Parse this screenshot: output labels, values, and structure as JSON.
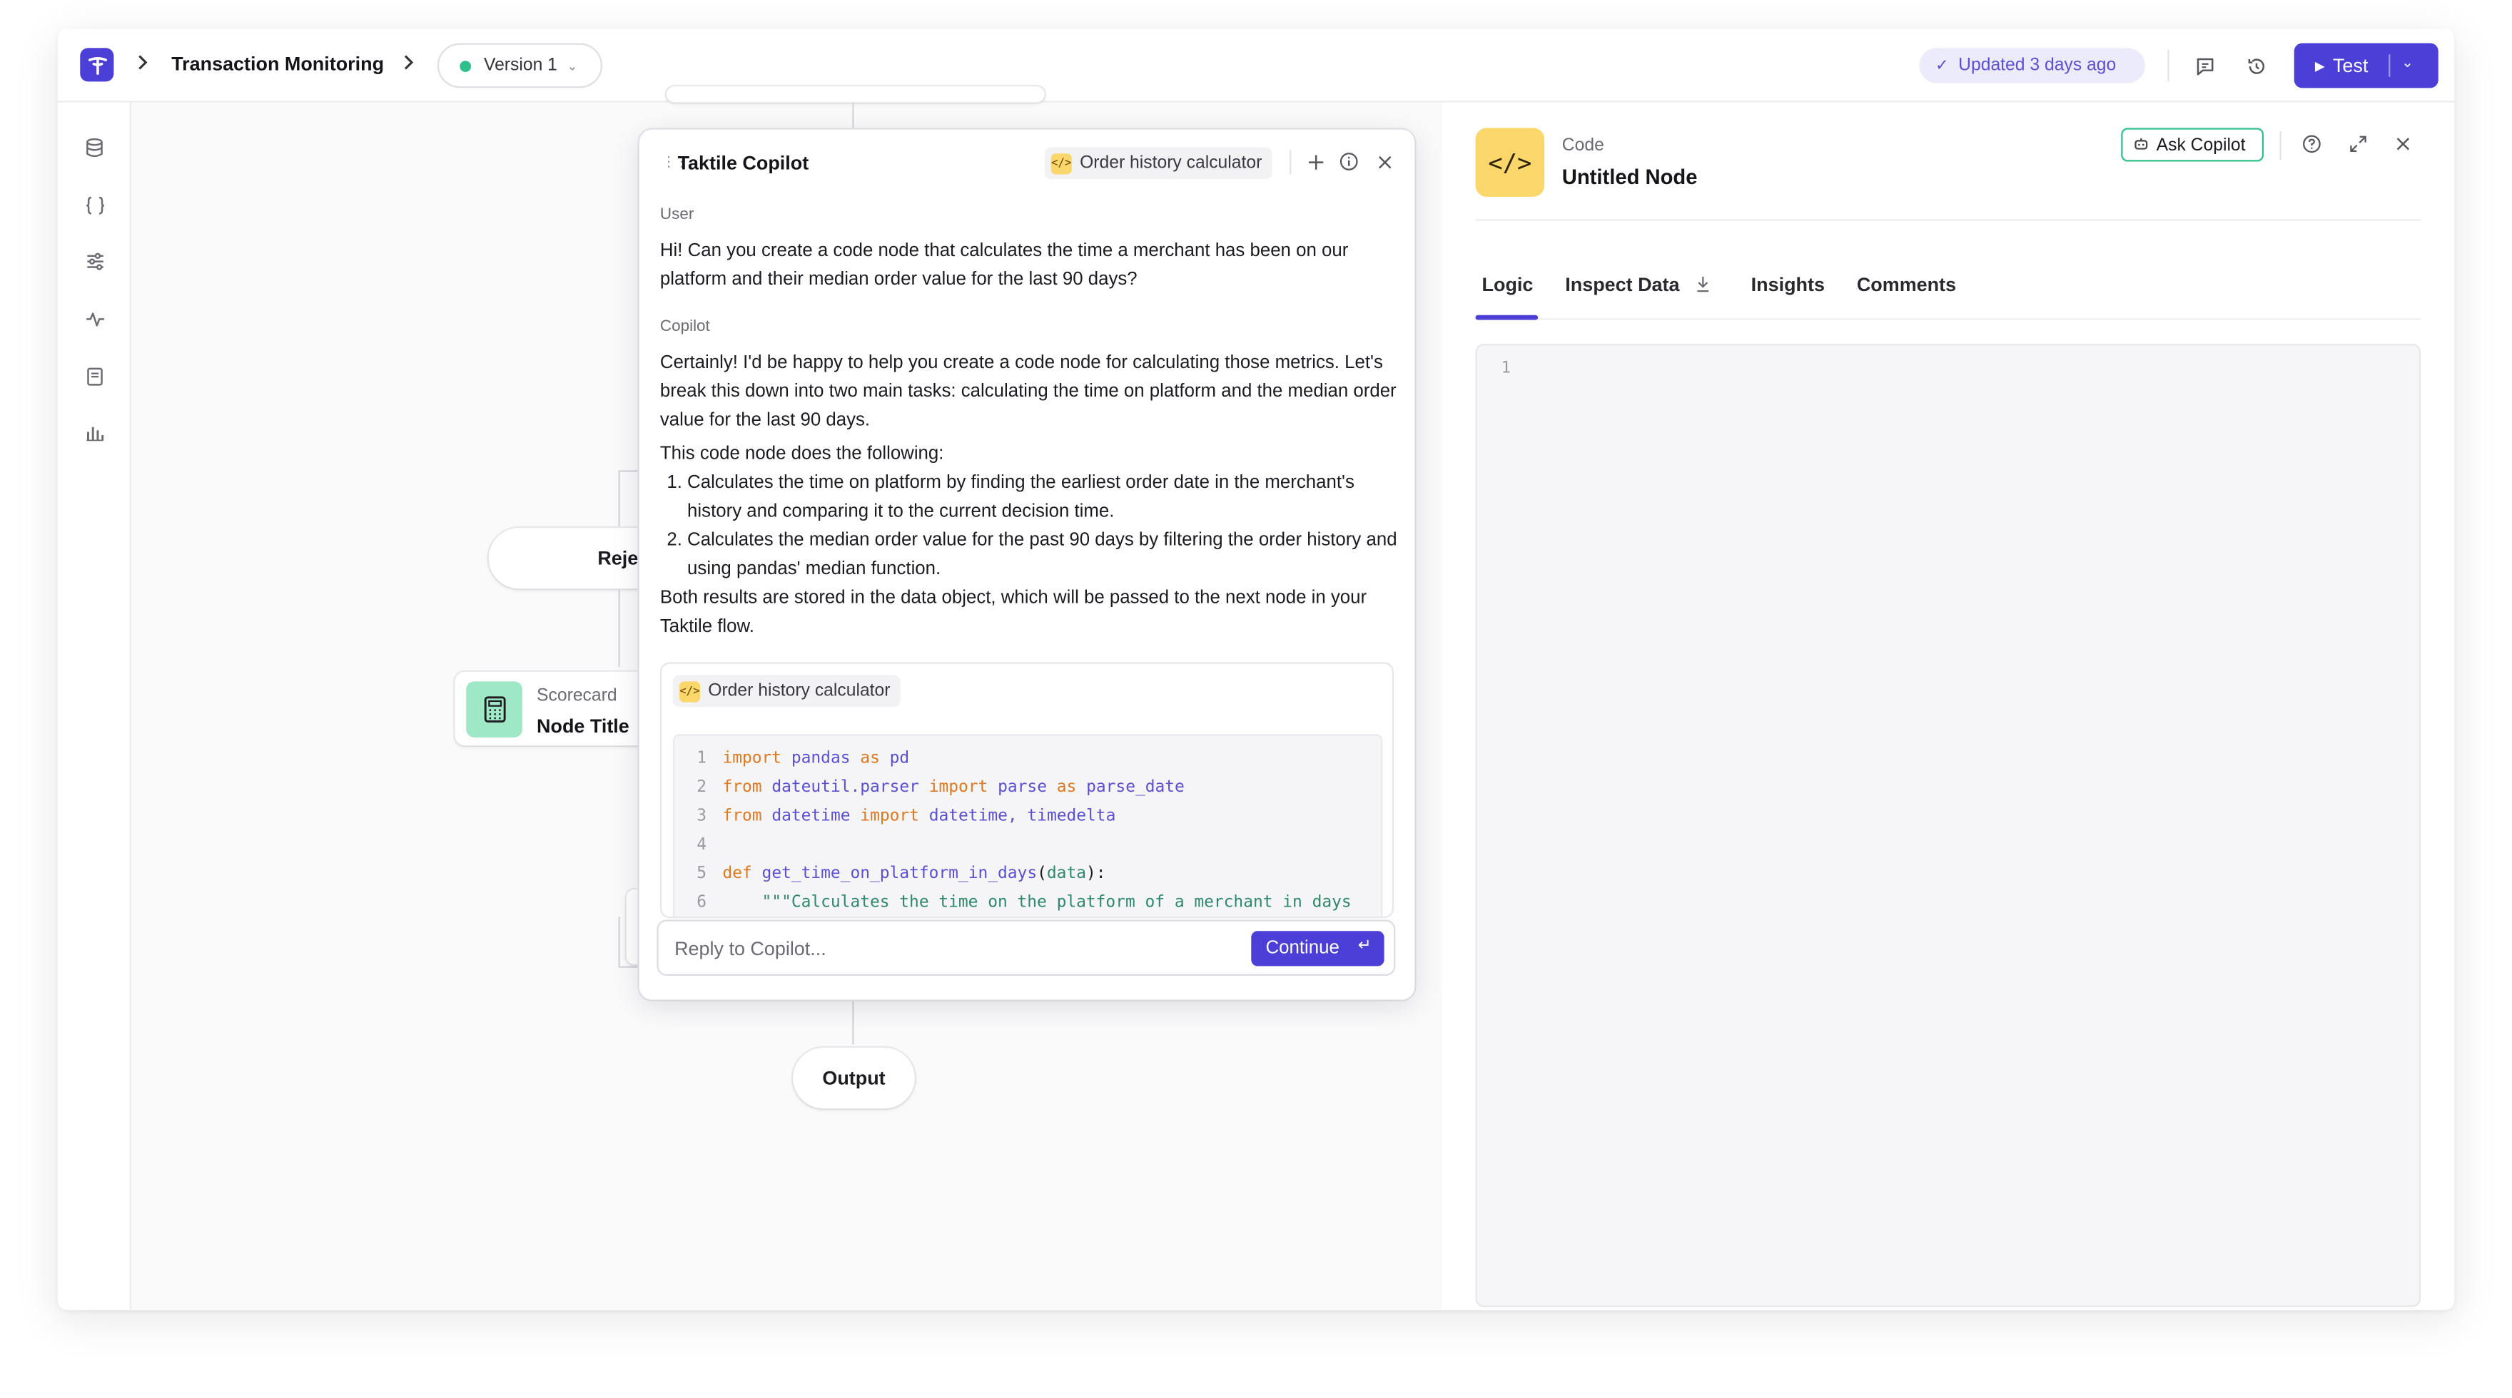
{
  "header": {
    "breadcrumb_title": "Transaction Monitoring",
    "version_label": "Version 1",
    "updated_label": "Updated 3 days ago",
    "test_label": "Test"
  },
  "sidebar": {
    "icons": [
      "database-icon",
      "braces-icon",
      "sliders-icon",
      "activity-icon",
      "book-icon",
      "bar-chart-icon"
    ]
  },
  "canvas": {
    "reject_node_label": "Rejec",
    "scorecard_node": {
      "type_label": "Scorecard",
      "title": "Node Title"
    },
    "output_node_label": "Output"
  },
  "copilot": {
    "title": "Taktile Copilot",
    "context_chip": "Order history calculator",
    "user_role": "User",
    "user_message": "Hi! Can you create a code node that calculates the time a merchant has been on our platform and their median order value for the last 90 days?",
    "assistant_role": "Copilot",
    "assistant_intro": "Certainly! I'd be happy to help you create a code node for calculating those metrics. Let's break this down into two main tasks: calculating the time on platform and the median order value for the last 90 days.",
    "assistant_explain": "This code node does the following:",
    "assistant_steps": [
      "Calculates the time on platform by finding the earliest order date in the merchant's history and comparing it to the current decision time.",
      "Calculates the median order value for the past 90 days by filtering the order history and using pandas' median function."
    ],
    "assistant_outro": "Both results are stored in the data object, which will be passed to the next node in your Taktile flow.",
    "code_card_title": "Order history calculator",
    "code_lines": [
      {
        "n": "1",
        "text": "import pandas as pd"
      },
      {
        "n": "2",
        "text": "from dateutil.parser import parse as parse_date"
      },
      {
        "n": "3",
        "text": "from datetime import datetime, timedelta"
      },
      {
        "n": "4",
        "text": ""
      },
      {
        "n": "5",
        "text": "def get_time_on_platform_in_days(data):"
      },
      {
        "n": "6",
        "text": "    \"\"\"Calculates the time on the platform of a merchant in days"
      }
    ],
    "reply_placeholder": "Reply to Copilot...",
    "continue_label": "Continue"
  },
  "node_panel": {
    "node_type": "Code",
    "node_title": "Untitled Node",
    "ask_copilot_label": "Ask Copilot",
    "tabs": [
      "Logic",
      "Inspect Data",
      "Insights",
      "Comments"
    ],
    "active_tab": "Logic",
    "editor_line_number": "1"
  },
  "colors": {
    "accent": "#4b3fd8",
    "code_icon_bg": "#fbd66b",
    "scorecard_icon_bg": "#9fe8c6",
    "status_green": "#2fbf8a"
  }
}
